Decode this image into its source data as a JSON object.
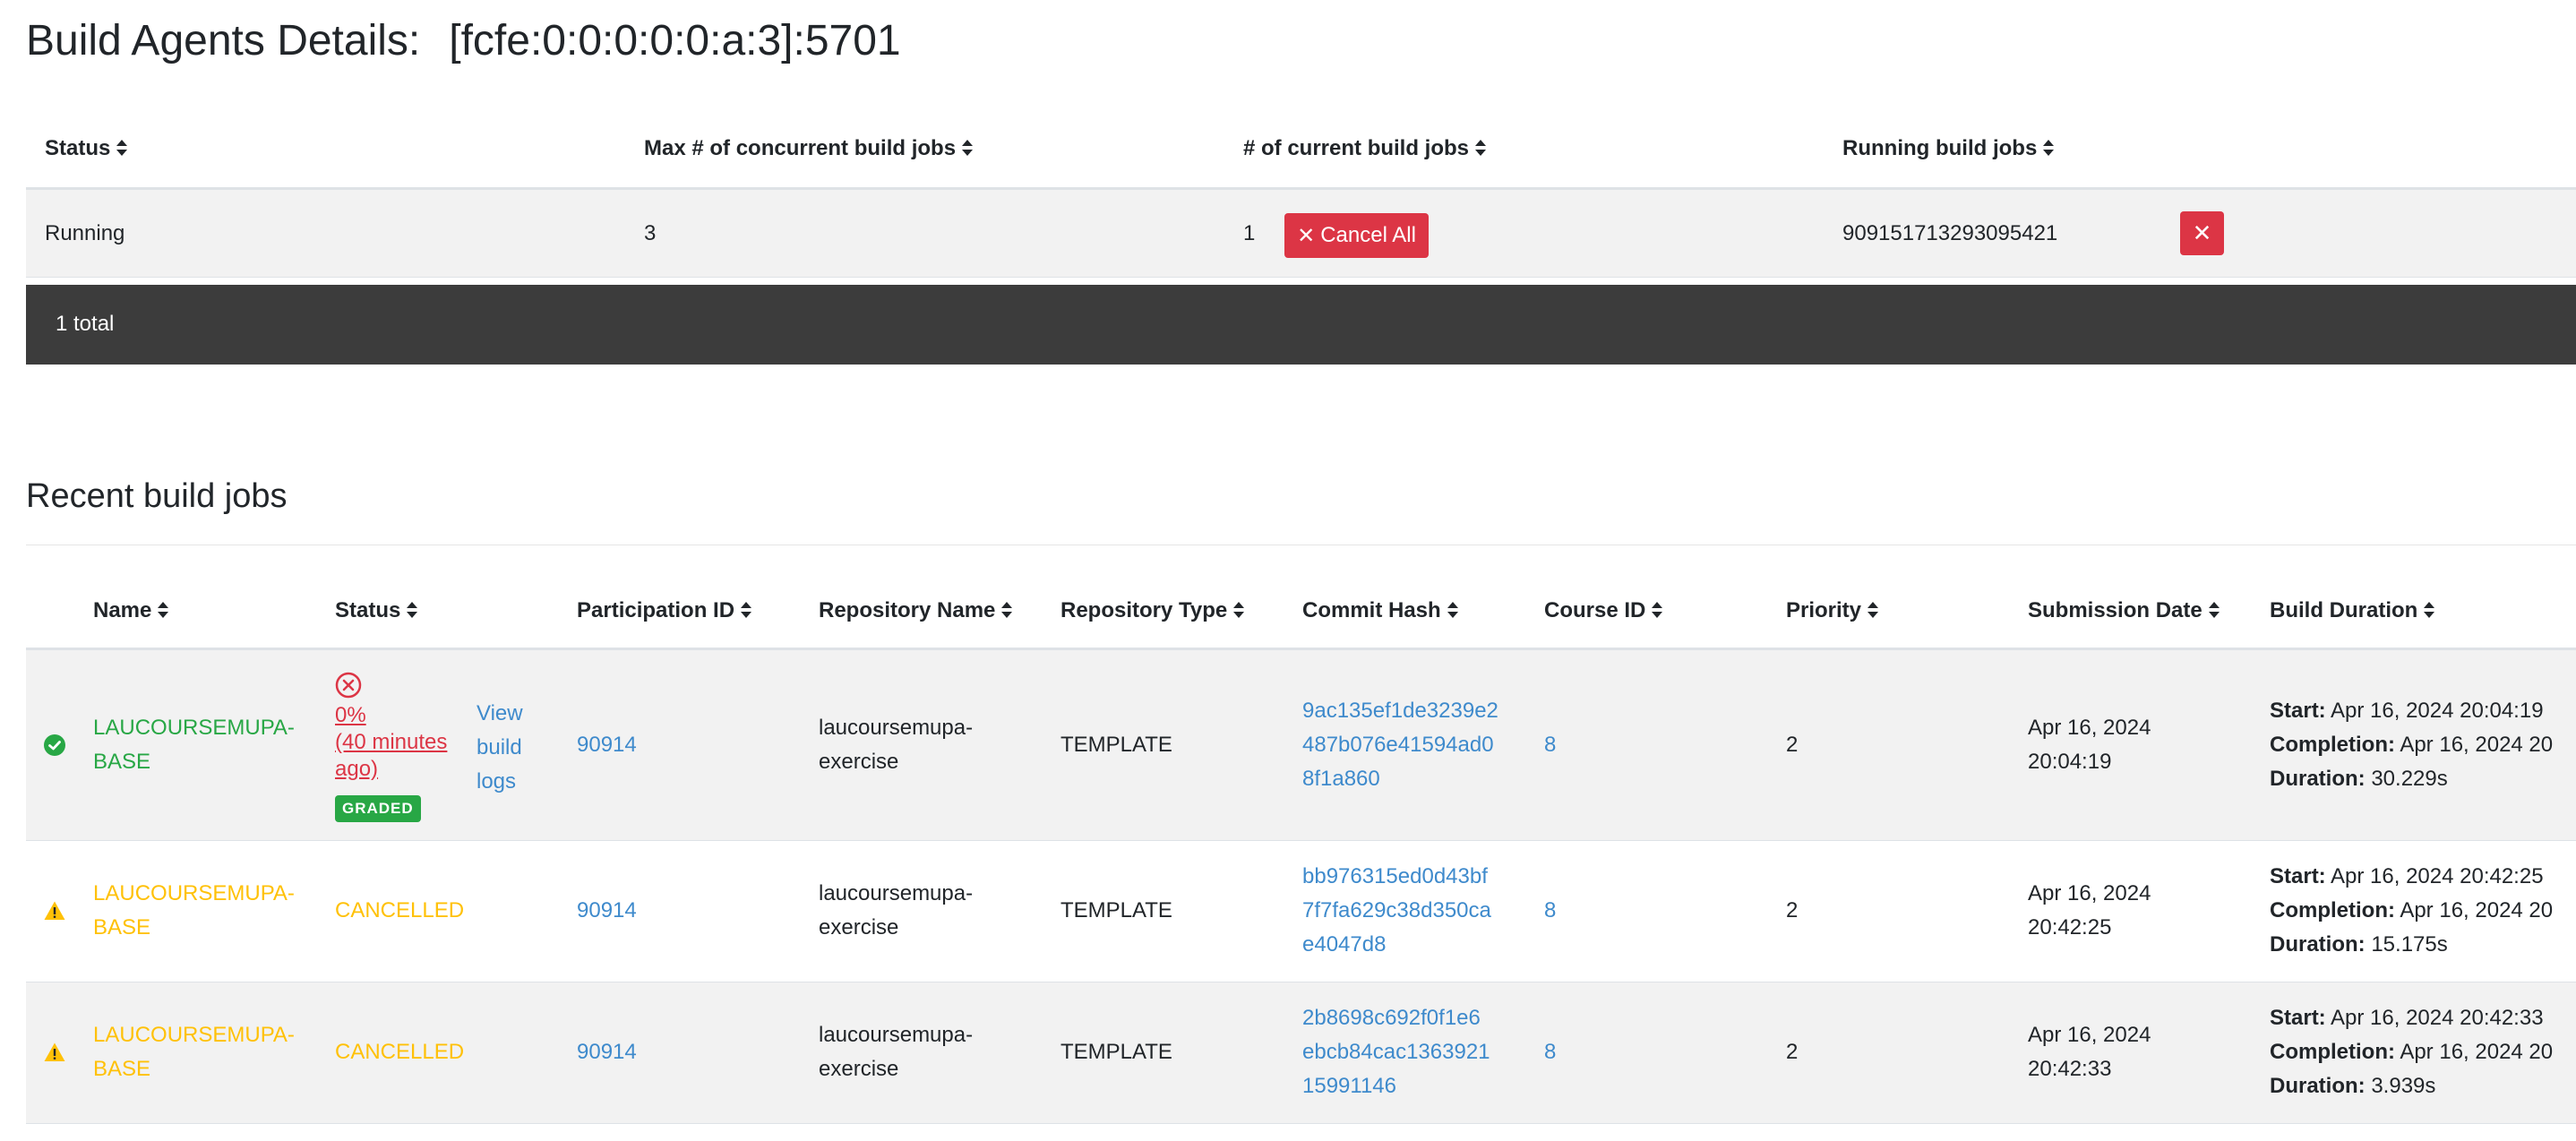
{
  "page": {
    "title": "Build Agents Details:",
    "address": "[fcfe:0:0:0:0:0:a:3]:5701"
  },
  "agent_table": {
    "headers": {
      "status": "Status",
      "max_jobs": "Max # of concurrent build jobs",
      "current_jobs": "# of current build jobs",
      "running_jobs": "Running build jobs"
    },
    "row": {
      "status": "Running",
      "max_jobs": "3",
      "current_jobs": "1",
      "cancel_all_label": "Cancel All",
      "running_job_id": "909151713293095421",
      "cancel_job_icon": "close-icon"
    },
    "total": "1 total"
  },
  "recent_jobs": {
    "title": "Recent build jobs",
    "headers": {
      "name": "Name",
      "status": "Status",
      "participation_id": "Participation ID",
      "repository_name": "Repository Name",
      "repository_type": "Repository Type",
      "commit_hash": "Commit Hash",
      "course_id": "Course ID",
      "priority": "Priority",
      "submission_date": "Submission Date",
      "build_duration": "Build Duration"
    },
    "labels": {
      "start": "Start:",
      "completion": "Completion:",
      "duration": "Duration:"
    },
    "rows": [
      {
        "status_icon": "check-circle-icon",
        "name_line1": "LAUCOURSEMUPA-",
        "name_line2": "BASE",
        "result_icon": "x-circle-icon",
        "result_line1": "0%",
        "result_line2": "(40 minutes",
        "result_line3": "ago)",
        "badge": "GRADED",
        "logs_line1": "View",
        "logs_line2": "build",
        "logs_line3": "logs",
        "participation_id": "90914",
        "repo_line1": "laucoursemupa-",
        "repo_line2": "exercise",
        "repository_type": "TEMPLATE",
        "hash_line1": "9ac135ef1de3239e2",
        "hash_line2": "487b076e41594ad0",
        "hash_line3": "8f1a860",
        "course_id": "8",
        "priority": "2",
        "date_line1": "Apr 16, 2024",
        "date_line2": "20:04:19",
        "start": "Apr 16, 2024 20:04:19",
        "completion": "Apr 16, 2024 20",
        "duration": "30.229s"
      },
      {
        "status_icon": "warning-triangle-icon",
        "name_line1": "LAUCOURSEMUPA-",
        "name_line2": "BASE",
        "status": "CANCELLED",
        "participation_id": "90914",
        "repo_line1": "laucoursemupa-",
        "repo_line2": "exercise",
        "repository_type": "TEMPLATE",
        "hash_line1": "bb976315ed0d43bf",
        "hash_line2": "7f7fa629c38d350ca",
        "hash_line3": "e4047d8",
        "course_id": "8",
        "priority": "2",
        "date_line1": "Apr 16, 2024",
        "date_line2": "20:42:25",
        "start": "Apr 16, 2024 20:42:25",
        "completion": "Apr 16, 2024 20",
        "duration": "15.175s"
      },
      {
        "status_icon": "warning-triangle-icon",
        "name_line1": "LAUCOURSEMUPA-",
        "name_line2": "BASE",
        "status": "CANCELLED",
        "participation_id": "90914",
        "repo_line1": "laucoursemupa-",
        "repo_line2": "exercise",
        "repository_type": "TEMPLATE",
        "hash_line1": "2b8698c692f0f1e6",
        "hash_line2": "ebcb84cac1363921",
        "hash_line3": "15991146",
        "course_id": "8",
        "priority": "2",
        "date_line1": "Apr 16, 2024",
        "date_line2": "20:42:33",
        "start": "Apr 16, 2024 20:42:33",
        "completion": "Apr 16, 2024 20",
        "duration": "3.939s"
      }
    ]
  },
  "colors": {
    "danger": "#dc3545",
    "success": "#28a745",
    "warning": "#ffc107",
    "link": "#3e8acc",
    "dark_bar": "#3c3c3c"
  }
}
